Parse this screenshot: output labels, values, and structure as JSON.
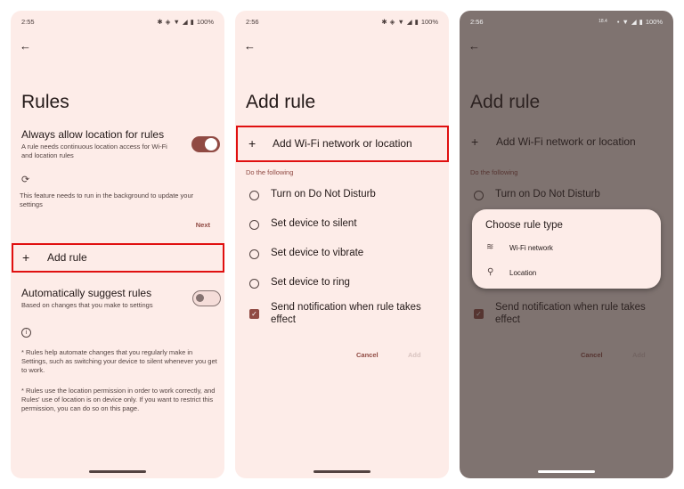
{
  "panel1": {
    "status": {
      "time": "2:55",
      "battery": "100%",
      "icons": [
        "bluetooth-icon",
        "vibrate-icon",
        "wifi-icon",
        "signal-icon",
        "battery-icon"
      ]
    },
    "title": "Rules",
    "always_allow": {
      "title": "Always allow location for rules",
      "subtitle": "A rule needs continuous location access for Wi-Fi and location rules",
      "toggle_on": true
    },
    "background_notice": "This feature needs to run in the background to update your settings",
    "next_label": "Next",
    "add_rule_label": "Add rule",
    "auto_suggest": {
      "title": "Automatically suggest rules",
      "subtitle": "Based on changes that you make to settings",
      "toggle_on": false
    },
    "info_1": "* Rules help automate changes that you regularly make in Settings, such as switching your device to silent whenever you get to work.",
    "info_2": "* Rules use the location permission in order to work correctly, and Rules' use of location is on device only. If you want to restrict this permission, you can do so on this page."
  },
  "panel2": {
    "status": {
      "time": "2:56",
      "battery": "100%"
    },
    "title": "Add rule",
    "add_trigger_label": "Add Wi-Fi network or location",
    "section_label": "Do the following",
    "options": [
      {
        "label": "Turn on Do Not Disturb",
        "selected": false
      },
      {
        "label": "Set device to silent",
        "selected": false
      },
      {
        "label": "Set device to vibrate",
        "selected": false
      },
      {
        "label": "Set device to ring",
        "selected": false
      }
    ],
    "notify": {
      "label": "Send notification when rule takes effect",
      "checked": true
    },
    "cancel_label": "Cancel",
    "add_label": "Add"
  },
  "panel3": {
    "status": {
      "time": "2:56",
      "data_rate": "18.4",
      "battery": "100%"
    },
    "dialog": {
      "title": "Choose rule type",
      "items": [
        {
          "label": "Wi-Fi network",
          "icon": "wifi-icon"
        },
        {
          "label": "Location",
          "icon": "location-pin-icon"
        }
      ]
    }
  },
  "colors": {
    "accent": "#904a43",
    "highlight": "#e01010",
    "surface": "#fdece8"
  }
}
